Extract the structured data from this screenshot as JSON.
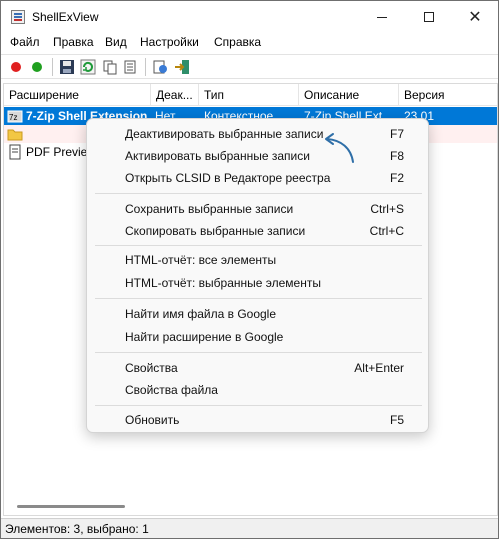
{
  "window": {
    "title": "ShellExView",
    "controls": {
      "minimize": "minimize-icon",
      "maximize": "maximize-icon",
      "close": "✕"
    }
  },
  "menubar": {
    "items": [
      "Файл",
      "Правка",
      "Вид",
      "Настройки",
      "Справка"
    ]
  },
  "toolbar": {
    "icons": [
      "disable-icon",
      "enable-icon",
      "save-icon",
      "refresh-icon",
      "copy-icon",
      "report-icon",
      "properties-icon",
      "exit-icon"
    ]
  },
  "list": {
    "columns": [
      "Расширение",
      "Деак...",
      "Тип",
      "Описание",
      "Версия"
    ],
    "rows": [
      {
        "name": "7-Zip Shell Extension",
        "disabled": "Нет",
        "type": "Контекстное ...",
        "description": "7-Zip Shell Ext...",
        "version": "23.01",
        "selected": true
      },
      {
        "name": "",
        "disabled": "",
        "type": "",
        "description": "",
        "version": "",
        "selected": false
      },
      {
        "name": "PDF Preview...",
        "disabled": "",
        "type": "",
        "description": "",
        "version": "",
        "selected": false
      }
    ]
  },
  "status": {
    "text": "Элементов: 3, выбрано: 1"
  },
  "context_menu": {
    "items": [
      {
        "label": "Деактивировать выбранные записи",
        "key": "F7"
      },
      {
        "label": "Активировать выбранные записи",
        "key": "F8"
      },
      {
        "label": "Открыть CLSID в Редакторе реестра",
        "key": "F2"
      },
      {
        "label": "Сохранить выбранные записи",
        "key": "Ctrl+S"
      },
      {
        "label": "Скопировать выбранные записи",
        "key": "Ctrl+C"
      },
      {
        "label": "HTML-отчёт: все элементы",
        "key": ""
      },
      {
        "label": "HTML-отчёт: выбранные элементы",
        "key": ""
      },
      {
        "label": "Найти имя файла в Google",
        "key": ""
      },
      {
        "label": "Найти расширение в Google",
        "key": ""
      },
      {
        "label": "Свойства",
        "key": "Alt+Enter"
      },
      {
        "label": "Свойства файла",
        "key": ""
      },
      {
        "label": "Обновить",
        "key": "F5"
      }
    ]
  },
  "colors": {
    "selection": "#0078d7",
    "annotation_arrow": "#2f6fa8",
    "disable_red": "#e02020",
    "enable_green": "#20a020"
  }
}
